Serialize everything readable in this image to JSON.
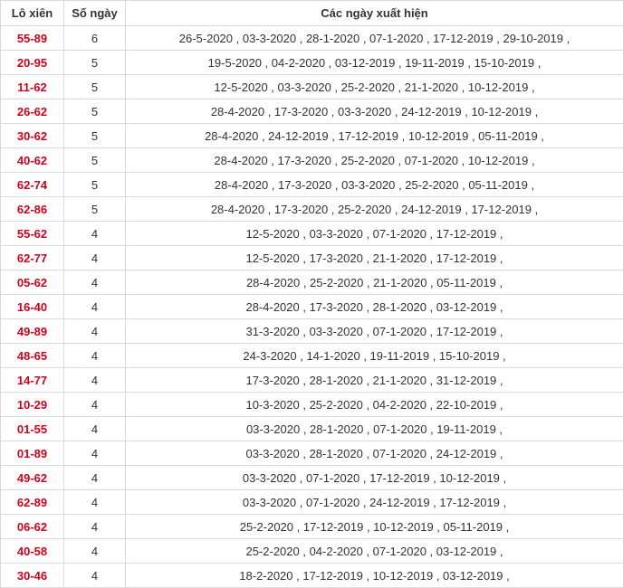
{
  "headers": [
    "Lô xiên",
    "Số ngày",
    "Các ngày xuất hiện"
  ],
  "colors": {
    "pair": "#d0021b",
    "text": "#333333",
    "border": "#d9d9d9"
  },
  "rows": [
    [
      "55-89",
      "6",
      "26-5-2020 , 03-3-2020 , 28-1-2020 , 07-1-2020 , 17-12-2019 , 29-10-2019 ,"
    ],
    [
      "20-95",
      "5",
      "19-5-2020 , 04-2-2020 , 03-12-2019 , 19-11-2019 , 15-10-2019 ,"
    ],
    [
      "11-62",
      "5",
      "12-5-2020 , 03-3-2020 , 25-2-2020 , 21-1-2020 , 10-12-2019 ,"
    ],
    [
      "26-62",
      "5",
      "28-4-2020 , 17-3-2020 , 03-3-2020 , 24-12-2019 , 10-12-2019 ,"
    ],
    [
      "30-62",
      "5",
      "28-4-2020 , 24-12-2019 , 17-12-2019 , 10-12-2019 , 05-11-2019 ,"
    ],
    [
      "40-62",
      "5",
      "28-4-2020 , 17-3-2020 , 25-2-2020 , 07-1-2020 , 10-12-2019 ,"
    ],
    [
      "62-74",
      "5",
      "28-4-2020 , 17-3-2020 , 03-3-2020 , 25-2-2020 , 05-11-2019 ,"
    ],
    [
      "62-86",
      "5",
      "28-4-2020 , 17-3-2020 , 25-2-2020 , 24-12-2019 , 17-12-2019 ,"
    ],
    [
      "55-62",
      "4",
      "12-5-2020 , 03-3-2020 , 07-1-2020 , 17-12-2019 ,"
    ],
    [
      "62-77",
      "4",
      "12-5-2020 , 17-3-2020 , 21-1-2020 , 17-12-2019 ,"
    ],
    [
      "05-62",
      "4",
      "28-4-2020 , 25-2-2020 , 21-1-2020 , 05-11-2019 ,"
    ],
    [
      "16-40",
      "4",
      "28-4-2020 , 17-3-2020 , 28-1-2020 , 03-12-2019 ,"
    ],
    [
      "49-89",
      "4",
      "31-3-2020 , 03-3-2020 , 07-1-2020 , 17-12-2019 ,"
    ],
    [
      "48-65",
      "4",
      "24-3-2020 , 14-1-2020 , 19-11-2019 , 15-10-2019 ,"
    ],
    [
      "14-77",
      "4",
      "17-3-2020 , 28-1-2020 , 21-1-2020 , 31-12-2019 ,"
    ],
    [
      "10-29",
      "4",
      "10-3-2020 , 25-2-2020 , 04-2-2020 , 22-10-2019 ,"
    ],
    [
      "01-55",
      "4",
      "03-3-2020 , 28-1-2020 , 07-1-2020 , 19-11-2019 ,"
    ],
    [
      "01-89",
      "4",
      "03-3-2020 , 28-1-2020 , 07-1-2020 , 24-12-2019 ,"
    ],
    [
      "49-62",
      "4",
      "03-3-2020 , 07-1-2020 , 17-12-2019 , 10-12-2019 ,"
    ],
    [
      "62-89",
      "4",
      "03-3-2020 , 07-1-2020 , 24-12-2019 , 17-12-2019 ,"
    ],
    [
      "06-62",
      "4",
      "25-2-2020 , 17-12-2019 , 10-12-2019 , 05-11-2019 ,"
    ],
    [
      "40-58",
      "4",
      "25-2-2020 , 04-2-2020 , 07-1-2020 , 03-12-2019 ,"
    ],
    [
      "30-46",
      "4",
      "18-2-2020 , 17-12-2019 , 10-12-2019 , 03-12-2019 ,"
    ]
  ]
}
